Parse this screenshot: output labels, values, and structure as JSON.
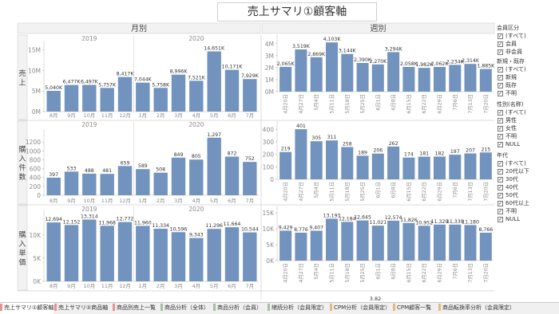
{
  "title": "売上サマリ①顧客軸",
  "panel_headers": {
    "monthly": "月別",
    "weekly": "週別"
  },
  "row_headers": [
    "売上",
    "購入件数",
    "購入単価"
  ],
  "year_labels": [
    "2019",
    "2020"
  ],
  "chart_data": [
    {
      "id": "monthly-sales",
      "type": "bar",
      "title": "",
      "ylabel": "売上",
      "categories": [
        "8月",
        "9月",
        "10月",
        "11月",
        "12月",
        "1月",
        "2月",
        "3月",
        "4月",
        "5月",
        "6月",
        "7月"
      ],
      "year_groups": [
        {
          "label": "2019",
          "count": 5
        },
        {
          "label": "2020",
          "count": 7
        }
      ],
      "values": [
        5040000,
        6477000,
        6497000,
        5757000,
        8417000,
        7044000,
        5758000,
        8996000,
        7521000,
        14651000,
        10171000,
        7929000
      ],
      "data_labels": [
        "5,040K",
        "6,477K",
        "6,497K",
        "5,757K",
        "8,417K",
        "7,044K",
        "5,758K",
        "8,996K",
        "7,521K",
        "14,651K",
        "10,171K",
        "7,929K"
      ],
      "yticks": [
        {
          "v": 0,
          "t": "0M"
        },
        {
          "v": 5000000,
          "t": "5M"
        },
        {
          "v": 10000000,
          "t": "10M"
        },
        {
          "v": 15000000,
          "t": "15M"
        }
      ],
      "ylim": [
        0,
        16500000
      ]
    },
    {
      "id": "monthly-count",
      "type": "bar",
      "title": "",
      "ylabel": "購入件数",
      "categories": [
        "8月",
        "9月",
        "10月",
        "11月",
        "12月",
        "1月",
        "2月",
        "3月",
        "4月",
        "5月",
        "6月",
        "7月"
      ],
      "year_groups": [
        {
          "label": "2019",
          "count": 5
        },
        {
          "label": "2020",
          "count": 7
        }
      ],
      "values": [
        397,
        533,
        488,
        481,
        659,
        589,
        508,
        849,
        805,
        1297,
        872,
        752
      ],
      "data_labels": [
        "397",
        "533",
        "488",
        "481",
        "659",
        "589",
        "508",
        "849",
        "805",
        "1,297",
        "872",
        "752"
      ],
      "yticks": [
        {
          "v": 0,
          "t": "0"
        },
        {
          "v": 200,
          "t": "200"
        },
        {
          "v": 400,
          "t": "400"
        },
        {
          "v": 600,
          "t": "600"
        },
        {
          "v": 800,
          "t": "800"
        },
        {
          "v": 1000,
          "t": "1000"
        },
        {
          "v": 1200,
          "t": "1200"
        }
      ],
      "ylim": [
        0,
        1420
      ]
    },
    {
      "id": "monthly-unit",
      "type": "bar",
      "title": "",
      "ylabel": "購入単価",
      "categories": [
        "8月",
        "9月",
        "10月",
        "11月",
        "12月",
        "1月",
        "2月",
        "3月",
        "4月",
        "5月",
        "6月",
        "7月"
      ],
      "year_groups": [
        {
          "label": "2019",
          "count": 5
        },
        {
          "label": "2020",
          "count": 7
        }
      ],
      "values": [
        12694,
        12152,
        13314,
        11968,
        12772,
        11960,
        11334,
        10596,
        9343,
        11296,
        11664,
        10544
      ],
      "data_labels": [
        "12,694",
        "12,152",
        "13,314",
        "11,968",
        "12,772",
        "11,960",
        "11,334",
        "10,596",
        "9,343",
        "11,296",
        "11,664",
        "10,544"
      ],
      "yticks": [
        {
          "v": 0,
          "t": "0K"
        },
        {
          "v": 5000,
          "t": "5K"
        },
        {
          "v": 10000,
          "t": "10K"
        }
      ],
      "ylim": [
        0,
        14600
      ]
    },
    {
      "id": "weekly-sales",
      "type": "bar",
      "title": "",
      "ylabel": "",
      "categories": [
        "4月20日",
        "4月27日",
        "5月4日",
        "5月11日",
        "5月18日",
        "5月25日",
        "6月1日",
        "6月8日",
        "6月15日",
        "6月22日",
        "6月29日",
        "7月6日",
        "7月13日",
        "7月20日"
      ],
      "values": [
        2065000,
        3519000,
        2869000,
        4103000,
        3144000,
        2390000,
        2270000,
        3294000,
        2058000,
        1982000,
        2062000,
        2234000,
        2314000,
        1885000
      ],
      "data_labels": [
        "2,065K",
        "3,519K",
        "2,869K",
        "4,103K",
        "3,144K",
        "2,390K",
        "2,270K",
        "3,294K",
        "2,058K",
        "1,982K",
        "2,062K",
        "2,234K",
        "2,314K",
        "1,885K"
      ],
      "yticks": [
        {
          "v": 0,
          "t": "0M"
        },
        {
          "v": 1000000,
          "t": "1M"
        },
        {
          "v": 2000000,
          "t": "2M"
        },
        {
          "v": 3000000,
          "t": "3M"
        },
        {
          "v": 4000000,
          "t": "4M"
        }
      ],
      "ylim": [
        0,
        4450000
      ]
    },
    {
      "id": "weekly-count",
      "type": "bar",
      "title": "",
      "ylabel": "",
      "categories": [
        "4月20日",
        "4月27日",
        "5月4日",
        "5月11日",
        "5月18日",
        "5月25日",
        "6月1日",
        "6月8日",
        "6月15日",
        "6月22日",
        "6月29日",
        "7月6日",
        "7月13日",
        "7月20日"
      ],
      "values": [
        219,
        401,
        305,
        311,
        258,
        189,
        206,
        262,
        174,
        181,
        182,
        197,
        207,
        215
      ],
      "data_labels": [
        "219",
        "401",
        "305",
        "311",
        "258",
        "189",
        "206",
        "262",
        "174",
        "181",
        "182",
        "197",
        "207",
        "215"
      ],
      "yticks": [
        {
          "v": 0,
          "t": "0"
        },
        {
          "v": 100,
          "t": "100"
        },
        {
          "v": 200,
          "t": "200"
        },
        {
          "v": 300,
          "t": "300"
        },
        {
          "v": 400,
          "t": "400"
        }
      ],
      "ylim": [
        0,
        440
      ]
    },
    {
      "id": "weekly-unit",
      "type": "bar",
      "title": "",
      "ylabel": "",
      "categories": [
        "4月20日",
        "4月27日",
        "5月4日",
        "5月11日",
        "5月18日",
        "5月25日",
        "6月1日",
        "6月8日",
        "6月15日",
        "6月22日",
        "6月29日",
        "7月6日",
        "7月13日",
        "7月20日"
      ],
      "values": [
        9429,
        8776,
        9407,
        13193,
        12184,
        12645,
        11021,
        12574,
        11826,
        10952,
        11329,
        11339,
        11180,
        8766
      ],
      "data_labels": [
        "9,429",
        "8,776",
        "9,407",
        "13,193",
        "12,184",
        "12,645",
        "11,021",
        "12,574",
        "11,826",
        "10,952",
        "11,329",
        "11,339",
        "11,180",
        "8,766"
      ],
      "yticks": [
        {
          "v": 0,
          "t": "0K"
        },
        {
          "v": 5000,
          "t": "5K"
        },
        {
          "v": 10000,
          "t": "10K"
        },
        {
          "v": 15000,
          "t": "15K"
        }
      ],
      "ylim": [
        0,
        16300
      ]
    }
  ],
  "footer_value": "3.82",
  "colors": {
    "bar": "#7193bd",
    "tab_swatch": [
      "#e9908d",
      "#e9908d",
      "#e9908d",
      "#a8bda2",
      "#a8bda2",
      "#a8bda2",
      "#e6b87a",
      "#e6b87a",
      "#e6b87a",
      "#e6b87a"
    ]
  },
  "filters": [
    {
      "title": "会員区分",
      "items": [
        "(すべて)",
        "会員",
        "非会員"
      ]
    },
    {
      "title": "新規・既存",
      "items": [
        "(すべて)",
        "新規",
        "既存",
        "不明"
      ]
    },
    {
      "title": "性別(名称)",
      "items": [
        "(すべて)",
        "男性",
        "女性",
        "不明",
        "NULL"
      ]
    },
    {
      "title": "年代",
      "items": [
        "(すべて)",
        "20代以下",
        "30代",
        "40代",
        "50代",
        "60代以上",
        "不明",
        "NULL"
      ]
    }
  ],
  "tabs": [
    "売上サマリ①顧客軸",
    "売上サマリ②商品軸",
    "商品別売上一覧",
    "商品分析（全体）",
    "商品分析（会員）",
    "継続分析（会員限定）",
    "CPM分析（会員限定）",
    "CPM顧客一覧",
    "商品転換率分析（会員限定）"
  ]
}
